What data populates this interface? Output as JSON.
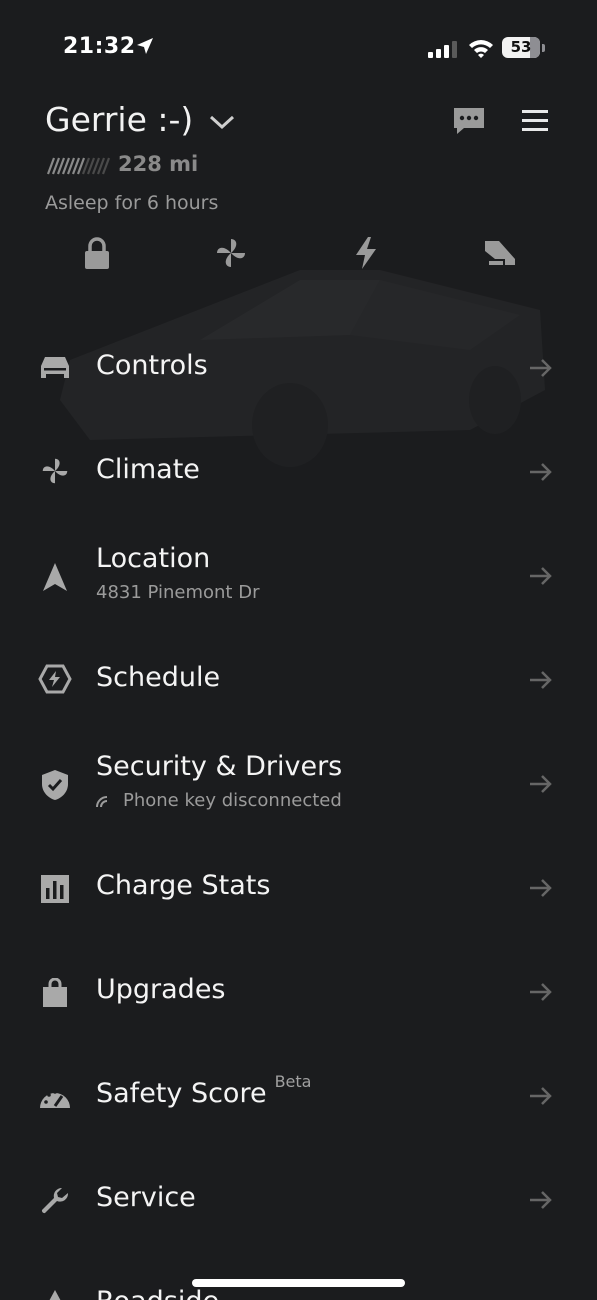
{
  "status_bar": {
    "time": "21:32",
    "battery": "53",
    "icons": [
      "location-arrow-icon",
      "cellular-signal-icon",
      "wifi-icon",
      "battery-icon"
    ]
  },
  "header": {
    "vehicle_name": "Gerrie :-)",
    "range": "228 mi",
    "status": "Asleep for 6 hours",
    "icons": [
      "chevron-down-icon",
      "message-icon",
      "menu-icon"
    ]
  },
  "quick_actions": [
    {
      "name": "lock",
      "icon": "lock-icon"
    },
    {
      "name": "climate",
      "icon": "fan-icon"
    },
    {
      "name": "charge",
      "icon": "bolt-icon"
    },
    {
      "name": "tonneau",
      "icon": "tonneau-icon"
    }
  ],
  "menu": {
    "items": [
      {
        "label": "Controls",
        "sub": "",
        "icon": "car-icon"
      },
      {
        "label": "Climate",
        "sub": "",
        "icon": "fan-icon"
      },
      {
        "label": "Location",
        "sub": "4831 Pinemont Dr",
        "icon": "navigation-icon"
      },
      {
        "label": "Schedule",
        "sub": "",
        "icon": "schedule-icon"
      },
      {
        "label": "Security & Drivers",
        "sub": "Phone key disconnected",
        "icon": "shield-icon"
      },
      {
        "label": "Charge Stats",
        "sub": "",
        "icon": "bar-chart-icon"
      },
      {
        "label": "Upgrades",
        "sub": "",
        "icon": "shopping-bag-icon"
      },
      {
        "label": "Safety Score",
        "badge": "Beta",
        "sub": "",
        "icon": "speedometer-icon"
      },
      {
        "label": "Service",
        "sub": "",
        "icon": "wrench-icon"
      },
      {
        "label": "Roadside",
        "sub": "",
        "icon": "warning-icon"
      }
    ]
  },
  "colors": {
    "background": "#1b1c1e",
    "text_primary": "#f4f4f4",
    "text_secondary": "#9b9b9b",
    "icon": "#a9a9a9"
  }
}
